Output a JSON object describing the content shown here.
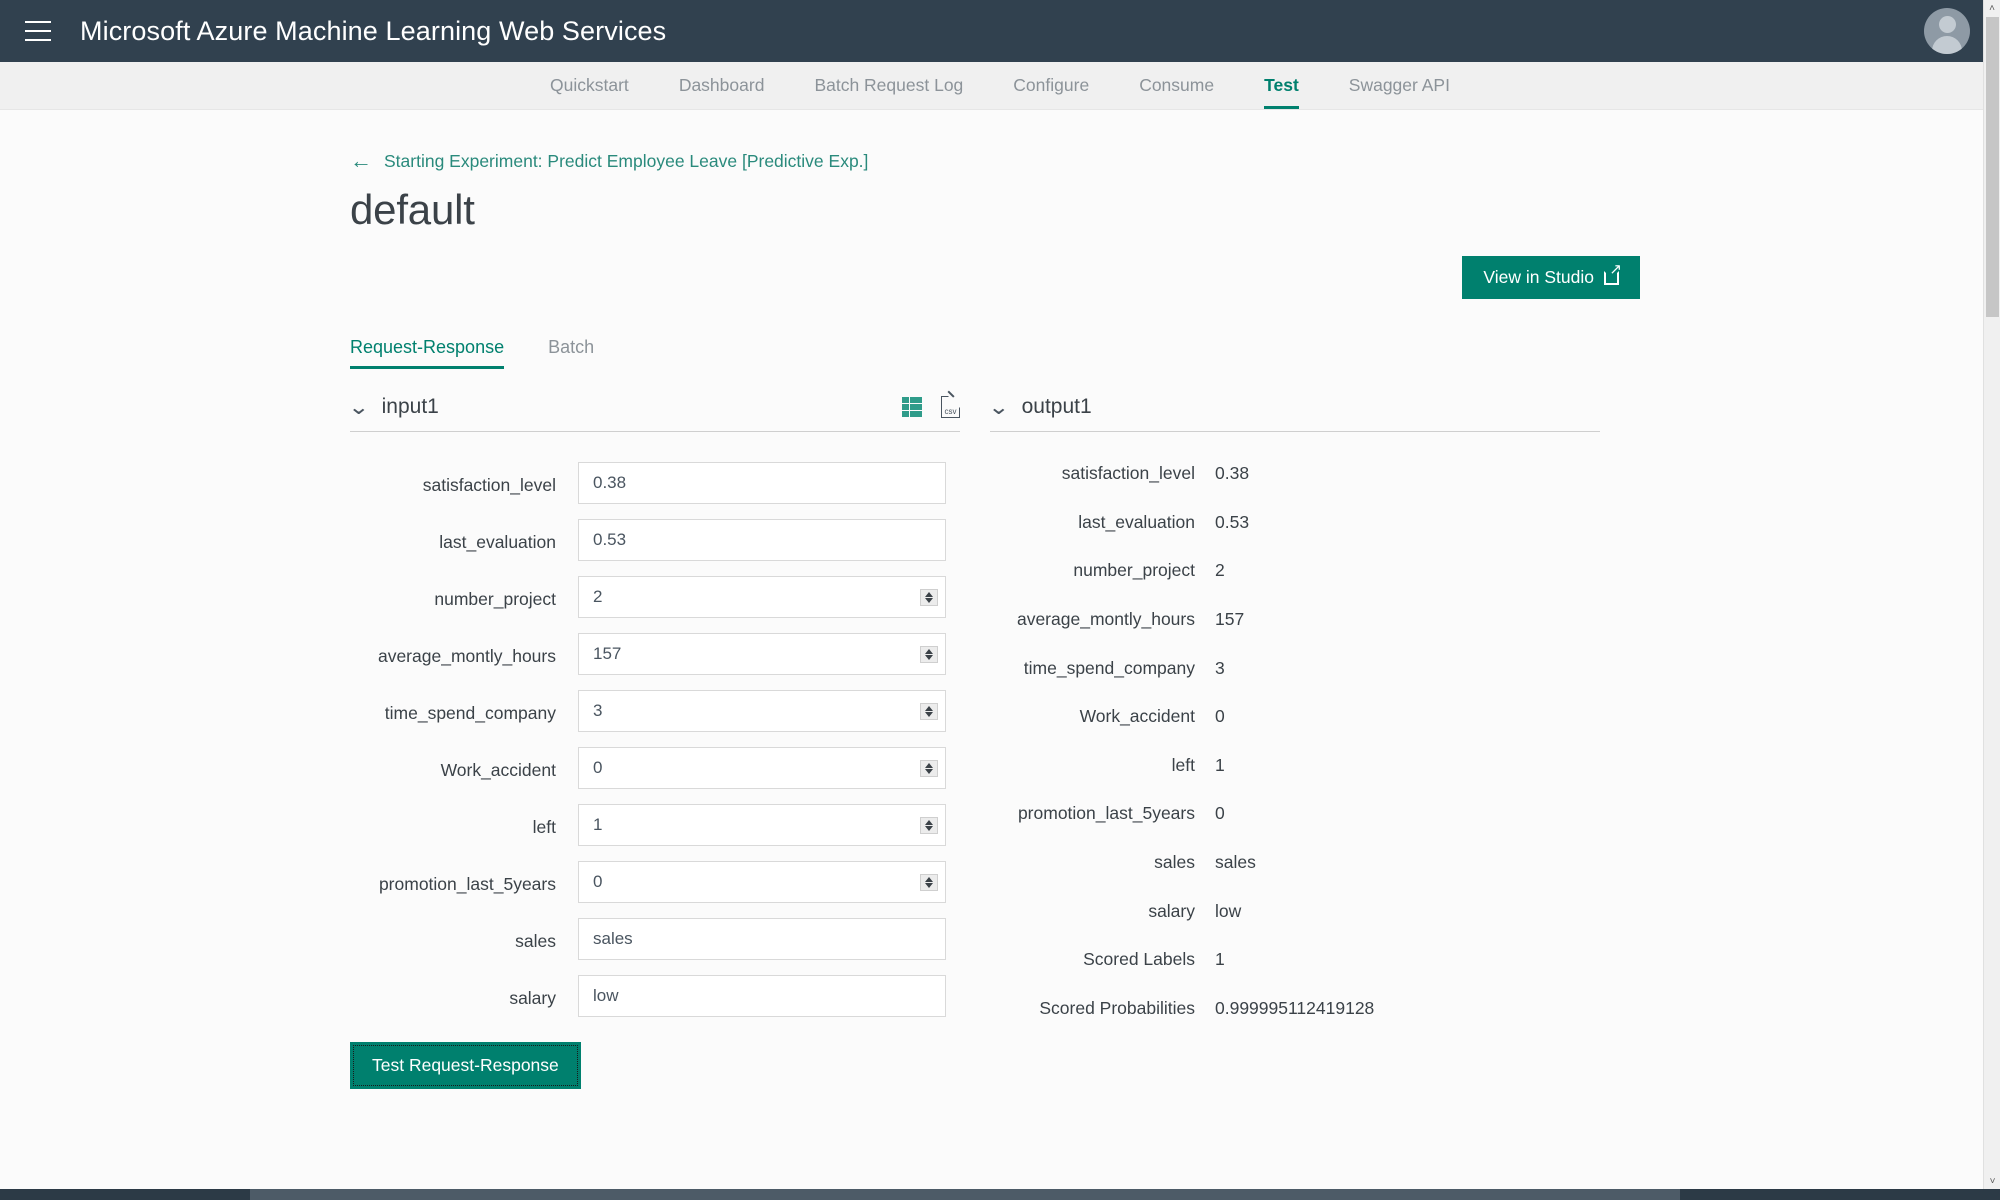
{
  "topbar": {
    "menu_icon": "hamburger-icon",
    "title": "Microsoft Azure Machine Learning Web Services",
    "avatar_icon": "user-avatar-icon"
  },
  "nav": {
    "tabs": [
      {
        "label": "Quickstart",
        "active": false
      },
      {
        "label": "Dashboard",
        "active": false
      },
      {
        "label": "Batch Request Log",
        "active": false
      },
      {
        "label": "Configure",
        "active": false
      },
      {
        "label": "Consume",
        "active": false
      },
      {
        "label": "Test",
        "active": true
      },
      {
        "label": "Swagger API",
        "active": false
      }
    ]
  },
  "page": {
    "breadcrumb": "Starting Experiment: Predict Employee Leave [Predictive Exp.]",
    "back_arrow": "←",
    "title": "default",
    "studio_button": "View in Studio"
  },
  "subtabs": [
    {
      "label": "Request-Response",
      "active": true
    },
    {
      "label": "Batch",
      "active": false
    }
  ],
  "input_panel": {
    "title": "input1",
    "chevron": "⌄",
    "icons": [
      {
        "name": "form-view-icon"
      },
      {
        "name": "csv-view-icon",
        "label": "CSV"
      }
    ],
    "fields": [
      {
        "label": "satisfaction_level",
        "value": "0.38",
        "spinner": false
      },
      {
        "label": "last_evaluation",
        "value": "0.53",
        "spinner": false
      },
      {
        "label": "number_project",
        "value": "2",
        "spinner": true
      },
      {
        "label": "average_montly_hours",
        "value": "157",
        "spinner": true
      },
      {
        "label": "time_spend_company",
        "value": "3",
        "spinner": true
      },
      {
        "label": "Work_accident",
        "value": "0",
        "spinner": true
      },
      {
        "label": "left",
        "value": "1",
        "spinner": true
      },
      {
        "label": "promotion_last_5years",
        "value": "0",
        "spinner": true
      },
      {
        "label": "sales",
        "value": "sales",
        "spinner": false
      },
      {
        "label": "salary",
        "value": "low",
        "spinner": false
      }
    ],
    "test_button": "Test Request-Response"
  },
  "output_panel": {
    "title": "output1",
    "chevron": "⌄",
    "rows": [
      {
        "label": "satisfaction_level",
        "value": "0.38"
      },
      {
        "label": "last_evaluation",
        "value": "0.53"
      },
      {
        "label": "number_project",
        "value": "2"
      },
      {
        "label": "average_montly_hours",
        "value": "157"
      },
      {
        "label": "time_spend_company",
        "value": "3"
      },
      {
        "label": "Work_accident",
        "value": "0"
      },
      {
        "label": "left",
        "value": "1"
      },
      {
        "label": "promotion_last_5years",
        "value": "0"
      },
      {
        "label": "sales",
        "value": "sales"
      },
      {
        "label": "salary",
        "value": "low"
      },
      {
        "label": "Scored Labels",
        "value": "1"
      },
      {
        "label": "Scored Probabilities",
        "value": "0.999995112419128"
      }
    ]
  },
  "colors": {
    "topbar_bg": "#31414f",
    "accent": "#00806e",
    "link": "#2a8a7c",
    "nav_bg": "#f0f0f0",
    "page_bg": "#fbfbfb",
    "text": "#3b4248",
    "muted": "#8c9399"
  },
  "scrollbars": {
    "vertical_up": "˄",
    "vertical_down": "˅"
  }
}
